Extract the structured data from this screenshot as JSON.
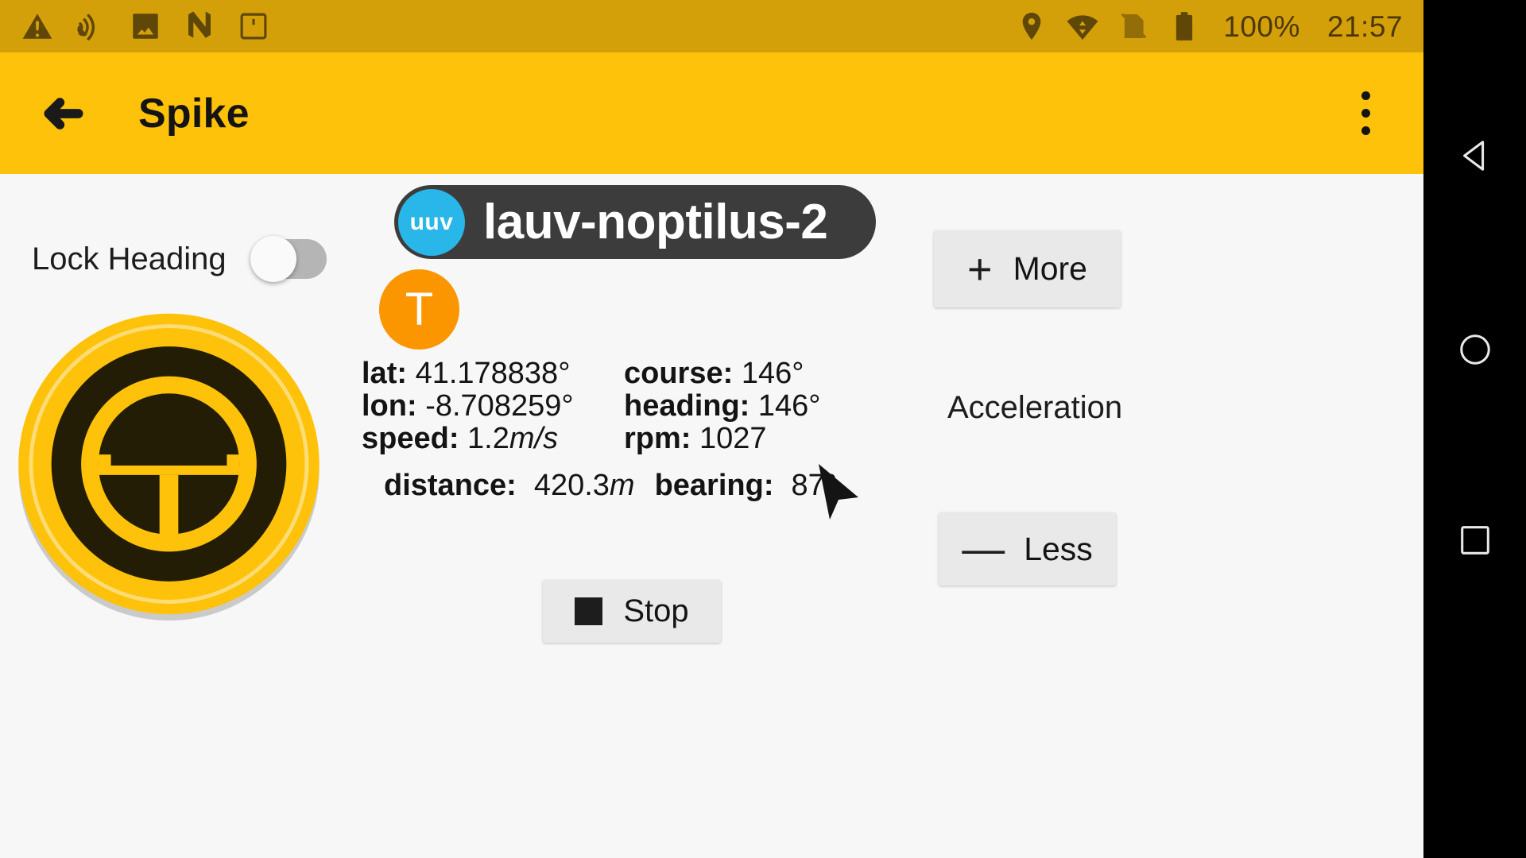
{
  "status_bar": {
    "background_color": "#d4a00a",
    "left_icons": [
      {
        "name": "warning-icon",
        "label": "warning"
      },
      {
        "name": "satellite-icon",
        "label": "satellite"
      },
      {
        "name": "image-icon",
        "label": "image"
      },
      {
        "name": "neptus-logo-icon",
        "label": "N"
      },
      {
        "name": "sim-card-icon",
        "label": "sim"
      }
    ],
    "right_icons": [
      {
        "name": "location-pin-icon",
        "label": "location"
      },
      {
        "name": "wifi-data-icon",
        "label": "wifi"
      },
      {
        "name": "signal-off-icon",
        "label": "no-signal"
      },
      {
        "name": "battery-full-icon",
        "label": "battery"
      }
    ],
    "battery_percent": "100%",
    "clock": "21:57"
  },
  "app_bar": {
    "background_color": "#ffc20a",
    "back_label": "back",
    "title": "Spike",
    "overflow_label": "more options"
  },
  "left_panel": {
    "lock_heading_label": "Lock Heading",
    "lock_heading_state": "off",
    "steering_wheel_label": "steering wheel"
  },
  "vehicle": {
    "type_badge": "uuv",
    "name": "lauv-noptilus-2",
    "pill_color": "#3c3c3c",
    "badge_color": "#29b6e8",
    "plan_badge_letter": "T",
    "plan_badge_color": "#fb9600"
  },
  "telemetry": {
    "rows": [
      {
        "key": "lat:",
        "value": "41.178838°",
        "unit": ""
      },
      {
        "key": "course:",
        "value": "146°",
        "unit": ""
      },
      {
        "key": "lon:",
        "value": "-8.708259°",
        "unit": ""
      },
      {
        "key": "heading:",
        "value": "146°",
        "unit": ""
      },
      {
        "key": "speed:",
        "value": "1.2",
        "unit": "m/s"
      },
      {
        "key": "rpm:",
        "value": "1027",
        "unit": ""
      }
    ],
    "distance_key": "distance:",
    "distance_value": "420.3",
    "distance_unit": "m",
    "bearing_key": "bearing:",
    "bearing_value": "87°",
    "bearing_arrow_label": "bearing arrow"
  },
  "controls": {
    "stop_label": "Stop",
    "more_glyph": "+",
    "more_label": "More",
    "less_glyph": "—",
    "less_label": "Less",
    "acceleration_label": "Acceleration"
  },
  "nav_bar": {
    "back_label": "back",
    "home_label": "home",
    "recents_label": "recents"
  }
}
